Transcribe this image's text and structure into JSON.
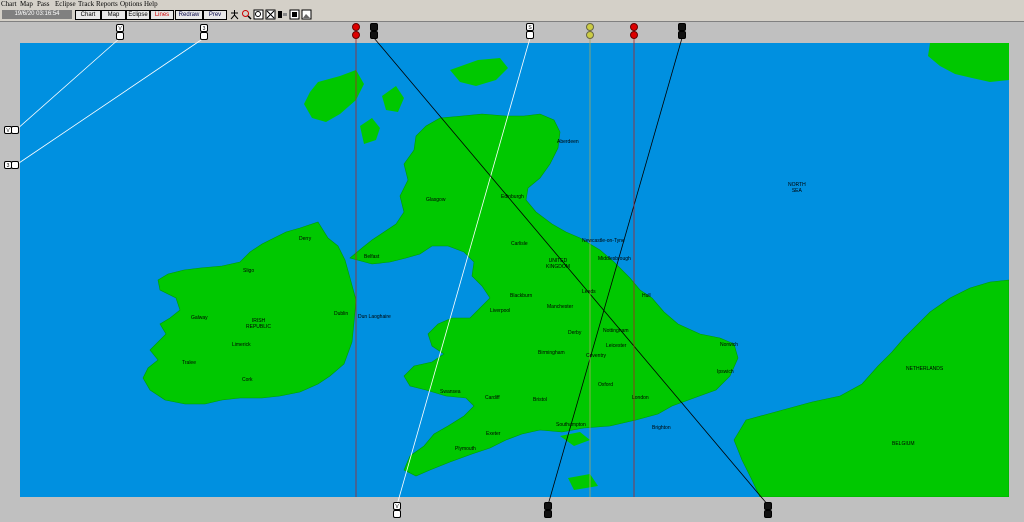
{
  "menu": [
    "Chart",
    "Map",
    "Pass",
    "Eclipse",
    "Track",
    "Reports",
    "Options",
    "Help"
  ],
  "datetime": "19/6/20 03:16:54",
  "toolbar_buttons": [
    "Chart",
    "Map",
    "Eclipse",
    "Lines",
    "Redraw",
    "Prev"
  ],
  "toolbar_icons": [
    "person-icon",
    "zoom-icon",
    "zoom-fit-icon",
    "pan-icon",
    "grid-icon",
    "layers-icon",
    "picture-icon"
  ],
  "colors": {
    "sea": "#0090e0",
    "land": "#00c800",
    "frame": "#c0c0c0"
  },
  "countries": [
    {
      "name": "IRISH\nREPUBLIC"
    },
    {
      "name": "UNITED\nKINGDOM"
    },
    {
      "name": "NORTH\nSEA"
    },
    {
      "name": "NETHERLANDS"
    },
    {
      "name": "BELGIUM"
    }
  ],
  "cities": [
    "Aberdeen",
    "Glasgow",
    "Edinburgh",
    "Carlisle",
    "Newcastle-on-Tyne",
    "Middlesbrough",
    "Derry",
    "Sligo",
    "Belfast",
    "Galway",
    "Dublin",
    "Dun Laoghaire",
    "Limerick",
    "Tralee",
    "Cork",
    "Blackburn",
    "Leeds",
    "Hull",
    "Liverpool",
    "Manchester",
    "Derby",
    "Nottingham",
    "Leicester",
    "Birmingham",
    "Coventry",
    "Norwich",
    "Ipswich",
    "Oxford",
    "Swansea",
    "Cardiff",
    "Bristol",
    "London",
    "Southampton",
    "Brighton",
    "Exeter",
    "Plymouth"
  ],
  "markers": {
    "top": [
      "V",
      "3",
      "R1",
      "S",
      "Y",
      "R2",
      "B",
      "S2"
    ],
    "left": [
      "V",
      "3"
    ],
    "bottom": [
      "V",
      "S",
      "S2"
    ]
  }
}
